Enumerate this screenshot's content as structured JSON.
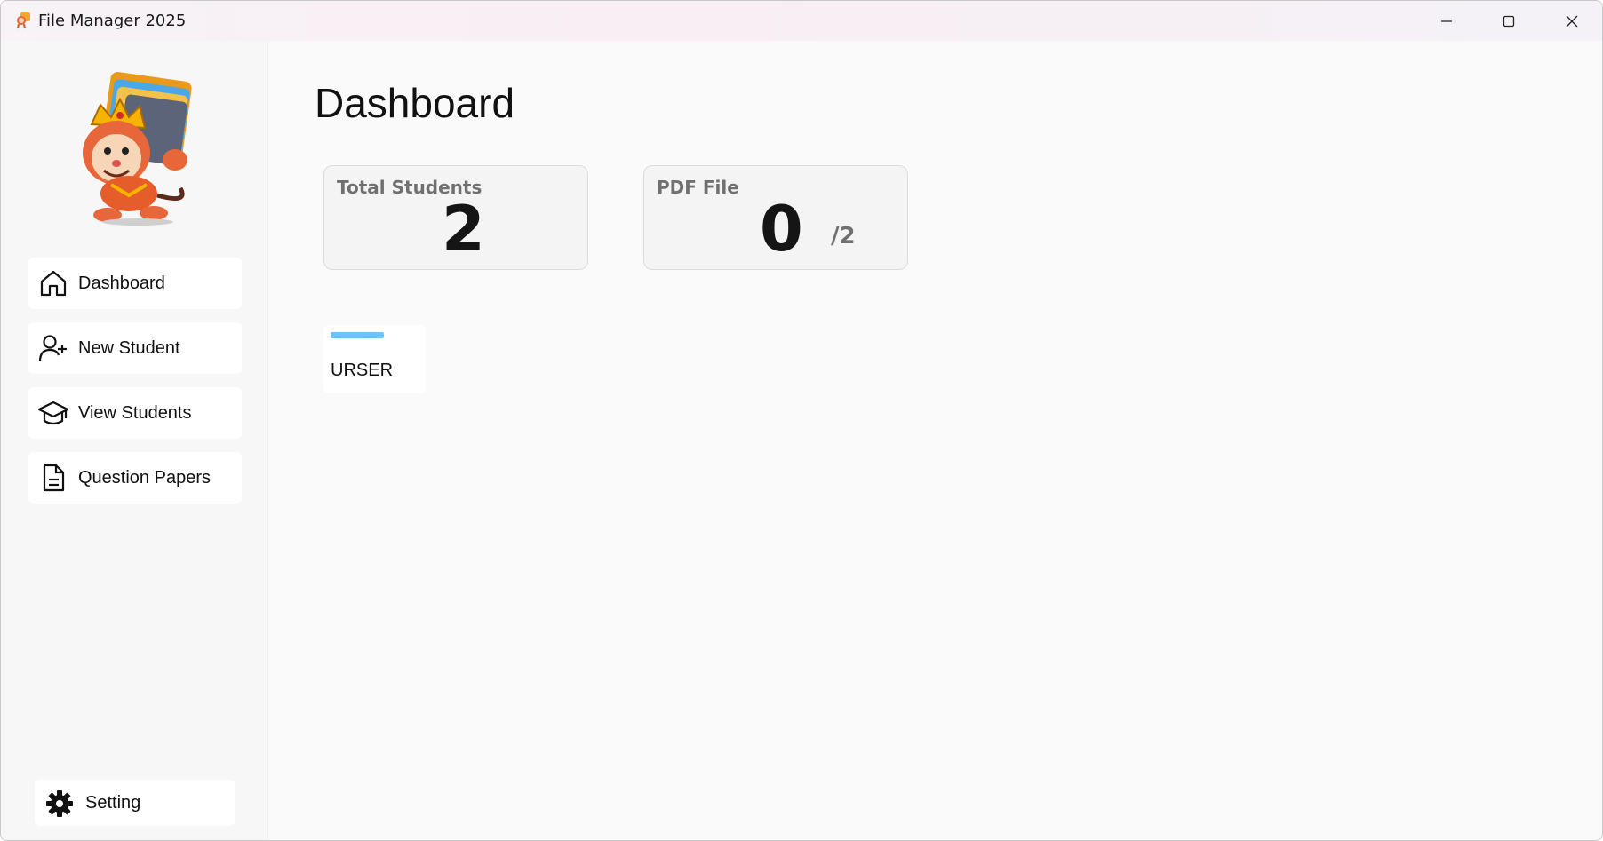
{
  "window": {
    "title": "File Manager 2025",
    "app_icon": "monkey-folder-mascot-icon",
    "controls": {
      "minimize_icon": "minimize-icon",
      "maximize_icon": "maximize-icon",
      "close_icon": "close-icon"
    }
  },
  "sidebar": {
    "logo": "monkey-carrying-folders-mascot",
    "items": [
      {
        "label": "Dashboard",
        "icon": "home-icon"
      },
      {
        "label": "New Student",
        "icon": "add-user-icon"
      },
      {
        "label": "View Students",
        "icon": "graduation-cap-icon"
      },
      {
        "label": "Question Papers",
        "icon": "document-icon"
      }
    ],
    "setting": {
      "label": "Setting",
      "icon": "gear-icon"
    }
  },
  "main": {
    "title": "Dashboard",
    "cards": [
      {
        "label": "Total Students",
        "value": "2"
      },
      {
        "label": "PDF File",
        "value": "0",
        "sub": "/2"
      }
    ],
    "tile": {
      "label": "URSER",
      "accent_color": "#6ec3f4"
    }
  },
  "colors": {
    "sidebar_bg": "#f7f7f7",
    "main_bg": "#fafafa",
    "card_bg": "#f4f4f4",
    "accent": "#6ec3f4"
  }
}
